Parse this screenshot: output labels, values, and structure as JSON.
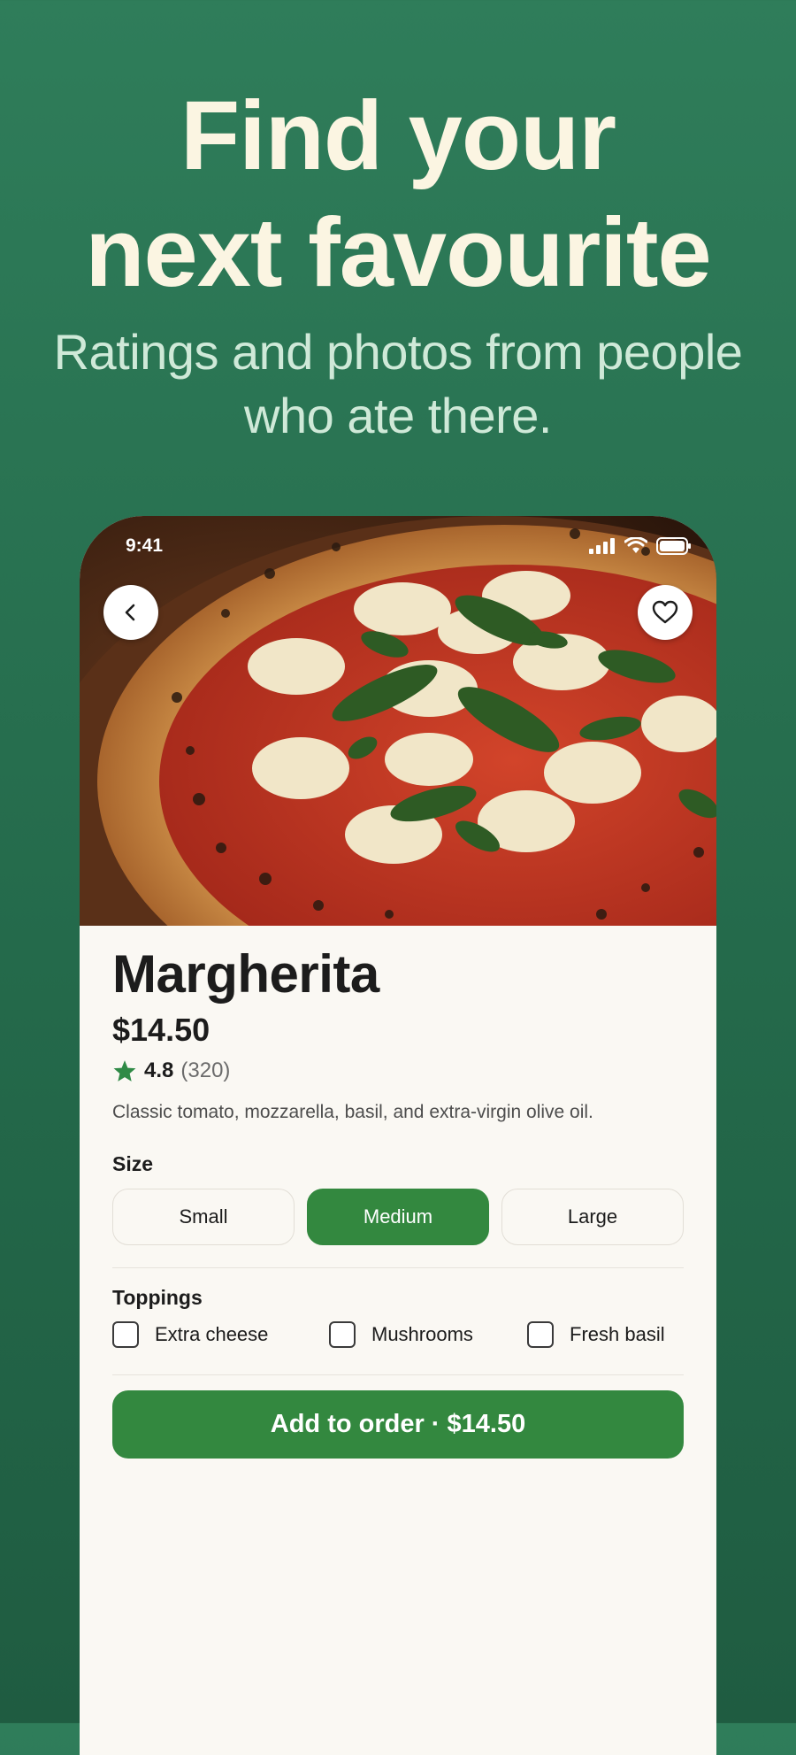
{
  "promo": {
    "headline_line1": "Find your",
    "headline_line2": "next favourite",
    "subline_line1": "Ratings and photos from people",
    "subline_line2": "who ate there."
  },
  "status_bar": {
    "time": "9:41",
    "icons": [
      "signal-icon",
      "wifi-icon",
      "battery-icon"
    ]
  },
  "hero": {
    "image": "margherita-pizza-photo",
    "back_icon": "chevron-left-icon",
    "favorite_icon": "heart-icon"
  },
  "product": {
    "name": "Margherita",
    "price": "$14.50",
    "rating": "4.8",
    "rating_count": "(320)",
    "description": "Classic tomato, mozzarella, basil, and extra-virgin olive oil."
  },
  "size": {
    "label": "Size",
    "options": [
      "Small",
      "Medium",
      "Large"
    ],
    "selected": "Medium"
  },
  "toppings": {
    "label": "Toppings",
    "options": [
      {
        "label": "Extra cheese",
        "checked": false
      },
      {
        "label": "Mushrooms",
        "checked": false
      },
      {
        "label": "Fresh basil",
        "checked": false
      }
    ]
  },
  "cta": {
    "label": "Add to order · $14.50"
  },
  "colors": {
    "background": "#2a7452",
    "accent": "#33883f",
    "headline": "#fbf5e2",
    "subline": "#cfe9d8",
    "card": "#faf8f3"
  }
}
